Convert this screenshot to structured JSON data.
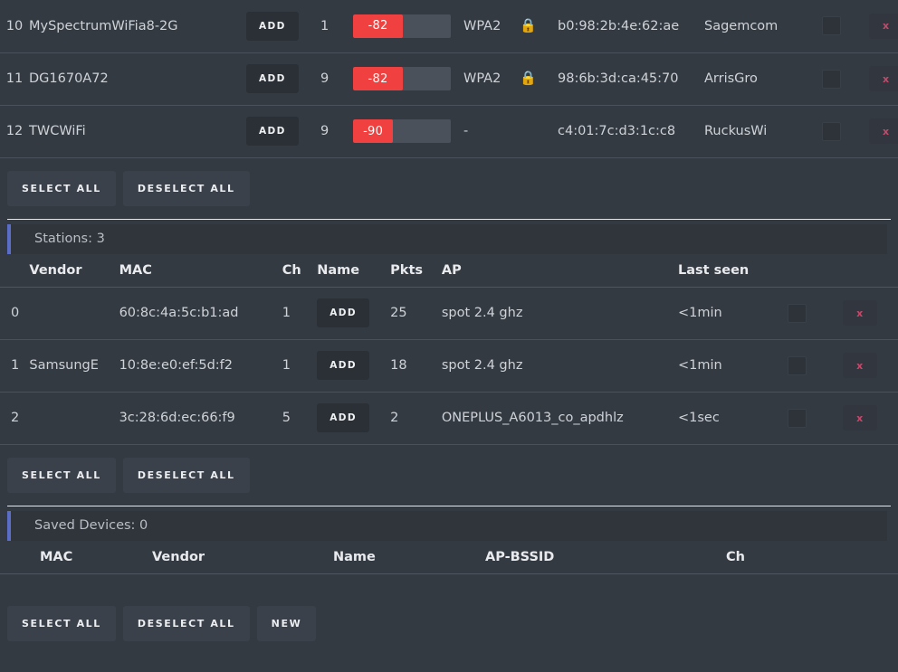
{
  "colors": {
    "page_bg": "#343a42",
    "row_border": "#4b515a",
    "accent_bar": "#5a6ec8",
    "signal_red": "#f0403f",
    "signal_track": "#4b515b",
    "delete_x": "#c8476a",
    "lock_icon": "#e8b339"
  },
  "access_points": {
    "columns_visible": false,
    "rows": [
      {
        "index": "10",
        "ssid": "MySpectrumWiFia8-2G",
        "add_label": "ADD",
        "channel": "1",
        "signal": "-82",
        "signal_pct": 51,
        "encryption": "WPA2",
        "lock_icon": "lock-icon",
        "bssid": "b0:98:2b:4e:62:ae",
        "vendor": "Sagemcom",
        "selected": false,
        "delete_label": "x"
      },
      {
        "index": "11",
        "ssid": "DG1670A72",
        "add_label": "ADD",
        "channel": "9",
        "signal": "-82",
        "signal_pct": 51,
        "encryption": "WPA2",
        "lock_icon": "lock-icon",
        "bssid": "98:6b:3d:ca:45:70",
        "vendor": "ArrisGro",
        "selected": false,
        "delete_label": "x"
      },
      {
        "index": "12",
        "ssid": "TWCWiFi",
        "add_label": "ADD",
        "channel": "9",
        "signal": "-90",
        "signal_pct": 41,
        "encryption": "-",
        "lock_icon": null,
        "bssid": "c4:01:7c:d3:1c:c8",
        "vendor": "RuckusWi",
        "selected": false,
        "delete_label": "x"
      }
    ],
    "select_all_label": "SELECT ALL",
    "deselect_all_label": "DESELECT ALL"
  },
  "stations": {
    "title": "Stations: 3",
    "columns": [
      "Vendor",
      "MAC",
      "Ch",
      "Name",
      "Pkts",
      "AP",
      "Last seen"
    ],
    "rows": [
      {
        "index": "0",
        "vendor": "",
        "mac": "60:8c:4a:5c:b1:ad",
        "channel": "1",
        "add_label": "ADD",
        "pkts": "25",
        "ap": "spot 2.4 ghz",
        "last_seen": "<1min",
        "selected": false,
        "delete_label": "x"
      },
      {
        "index": "1",
        "vendor": "SamsungE",
        "mac": "10:8e:e0:ef:5d:f2",
        "channel": "1",
        "add_label": "ADD",
        "pkts": "18",
        "ap": "spot 2.4 ghz",
        "last_seen": "<1min",
        "selected": false,
        "delete_label": "x"
      },
      {
        "index": "2",
        "vendor": "",
        "mac": "3c:28:6d:ec:66:f9",
        "channel": "5",
        "add_label": "ADD",
        "pkts": "2",
        "ap": "ONEPLUS_A6013_co_apdhlz",
        "last_seen": "<1sec",
        "selected": false,
        "delete_label": "x"
      }
    ],
    "select_all_label": "SELECT ALL",
    "deselect_all_label": "DESELECT ALL"
  },
  "saved_devices": {
    "title": "Saved Devices: 0",
    "columns": [
      "MAC",
      "Vendor",
      "Name",
      "AP-BSSID",
      "Ch"
    ],
    "rows": [],
    "select_all_label": "SELECT ALL",
    "deselect_all_label": "DESELECT ALL",
    "new_label": "NEW"
  }
}
